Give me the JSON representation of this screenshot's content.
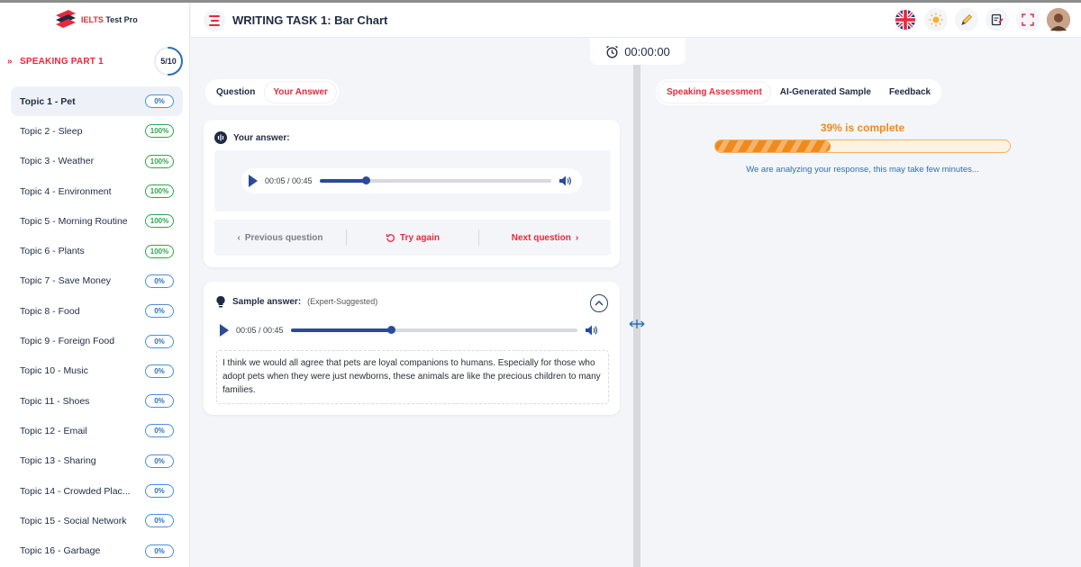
{
  "brand": {
    "name_a": "IELTS",
    "name_b": " Test Pro"
  },
  "sidebar": {
    "section_title": "SPEAKING PART 1",
    "section_progress": "5/10",
    "section_progress_fraction": 0.5,
    "topics": [
      {
        "label": "Topic 1 - Pet",
        "percent": "0%"
      },
      {
        "label": "Topic 2 - Sleep",
        "percent": "100%"
      },
      {
        "label": "Topic 3 - Weather",
        "percent": "100%"
      },
      {
        "label": "Topic 4 - Environment",
        "percent": "100%"
      },
      {
        "label": "Topic 5 - Morning Routine",
        "percent": "100%"
      },
      {
        "label": "Topic 6 - Plants",
        "percent": "100%"
      },
      {
        "label": "Topic 7 - Save Money",
        "percent": "0%"
      },
      {
        "label": "Topic 8 - Food",
        "percent": "0%"
      },
      {
        "label": "Topic 9 - Foreign Food",
        "percent": "0%"
      },
      {
        "label": "Topic 10 - Music",
        "percent": "0%"
      },
      {
        "label": "Topic 11 - Shoes",
        "percent": "0%"
      },
      {
        "label": "Topic 12 - Email",
        "percent": "0%"
      },
      {
        "label": "Topic 13 - Sharing",
        "percent": "0%"
      },
      {
        "label": "Topic 14 - Crowded Plac...",
        "percent": "0%"
      },
      {
        "label": "Topic 15 - Social Network",
        "percent": "0%"
      },
      {
        "label": "Topic 16 - Garbage",
        "percent": "0%"
      }
    ]
  },
  "header": {
    "title": "WRITING TASK 1: Bar Chart"
  },
  "timer": {
    "value": "00:00:00"
  },
  "left_tabs": {
    "question": "Question",
    "your_answer": "Your Answer"
  },
  "answer_card": {
    "title": "Your answer:",
    "player_time": "00:05 / 00:45",
    "player_progress": 0.2,
    "prev": "Previous question",
    "retry": "Try again",
    "next": "Next question"
  },
  "sample_card": {
    "title": "Sample answer:",
    "subtitle": "(Expert-Suggested)",
    "player_time": "00:05 / 00:45",
    "player_progress": 0.35,
    "text": "I think we would all agree that pets are loyal companions to humans. Especially for those who adopt pets when they were just newborns, these animals are like the precious children to many families."
  },
  "right_tabs": {
    "assessment": "Speaking Assessment",
    "ai_sample": "AI-Generated Sample",
    "feedback": "Feedback"
  },
  "assessment": {
    "progress_label": "39% is complete",
    "progress_fraction": 0.39,
    "note": "We are analyzing  your response, this may take few minutes..."
  },
  "colors": {
    "accent": "#e8283d",
    "navy": "#1f2a44",
    "player": "#2b4a9a",
    "progress": "#f08a1c",
    "done": "#2fa54d"
  }
}
